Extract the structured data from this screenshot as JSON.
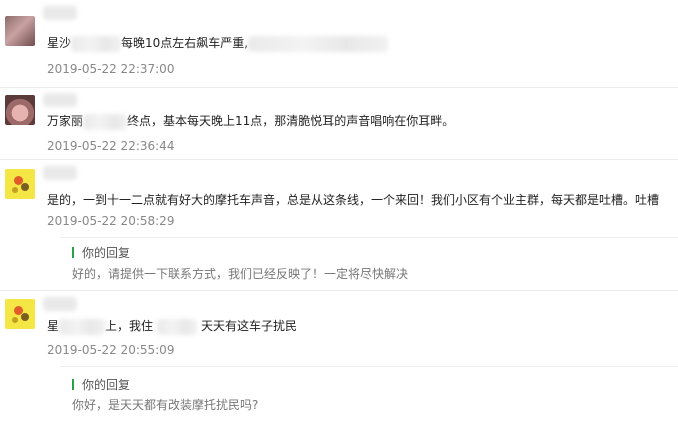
{
  "comments": [
    {
      "text_a": "星沙",
      "text_b": "每晚10点左右飙车严重,",
      "time": "2019-05-22 22:37:00"
    },
    {
      "text_a": "万家丽",
      "text_b": "终点，基本每天晚上11点，那清脆悦耳的声音唱响在你耳畔。",
      "time": "2019-05-22 22:36:44"
    },
    {
      "text": "是的，一到十一二点就有好大的摩托车声音，总是从这条线，一个来回！我们小区有个业主群，每天都是吐槽。吐槽",
      "time": "2019-05-22 20:58:29",
      "reply": {
        "label": "你的回复",
        "text": "好的，请提供一下联系方式，我们已经反映了！一定将尽快解决"
      }
    },
    {
      "text_a": "星",
      "text_b": "上，我住",
      "text_c": "天天有这车子扰民",
      "time": "2019-05-22 20:55:09",
      "reply": {
        "label": "你的回复",
        "text": "你好，是天天都有改装摩托扰民吗?"
      }
    }
  ],
  "colors": {
    "reply_bar": "#2aa144",
    "time": "#888888",
    "text": "#222222"
  }
}
